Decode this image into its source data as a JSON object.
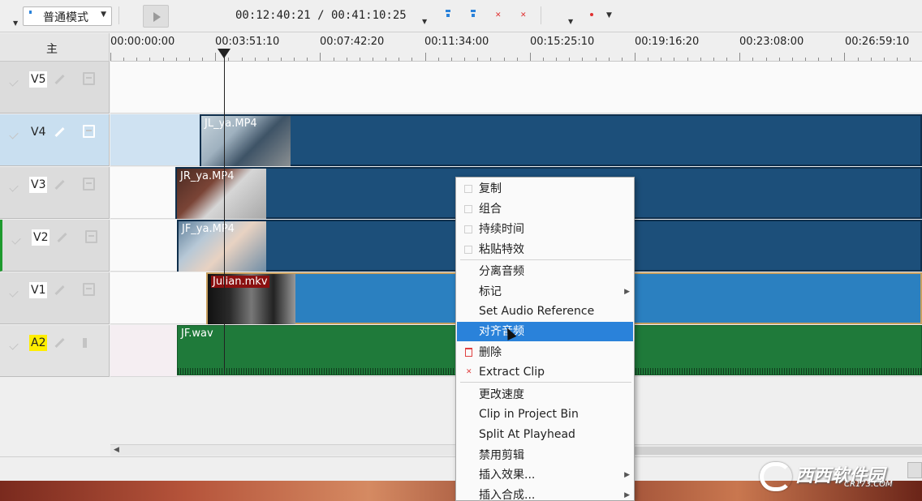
{
  "toolbar": {
    "mode": "普通模式",
    "timecode": "00:12:40:21 / 00:41:10:25"
  },
  "track_header": {
    "label": "主"
  },
  "ruler": {
    "labels": [
      "00:00:00:00",
      "00:03:51:10",
      "00:07:42:20",
      "00:11:34:00",
      "00:15:25:10",
      "00:19:16:20",
      "00:23:08:00",
      "00:26:59:10"
    ]
  },
  "tracks": [
    {
      "name": "V5"
    },
    {
      "name": "V4"
    },
    {
      "name": "V3"
    },
    {
      "name": "V2"
    },
    {
      "name": "V1"
    },
    {
      "name": "A2"
    }
  ],
  "clips": {
    "v4": "JL_ya.MP4",
    "v3": "JR_ya.MP4",
    "v2": "JF_ya.MP4",
    "v1": "Julian.mkv",
    "a2": "JF.wav"
  },
  "context_menu": {
    "items": [
      {
        "label": "复制",
        "icon": "copy-icon"
      },
      {
        "label": "组合",
        "icon": "group-icon"
      },
      {
        "label": "持续时间",
        "icon": "duration-icon"
      },
      {
        "label": "粘贴特效",
        "icon": "paste-effect-icon"
      },
      {
        "label": "分离音频"
      },
      {
        "label": "标记",
        "submenu": true
      },
      {
        "label": "Set Audio Reference"
      },
      {
        "label": "对齐音频",
        "selected": true
      },
      {
        "label": "删除",
        "icon": "trash-icon"
      },
      {
        "label": "Extract Clip",
        "icon": "extract-icon"
      },
      {
        "label": "更改速度"
      },
      {
        "label": "Clip in Project Bin"
      },
      {
        "label": "Split At Playhead"
      },
      {
        "label": "禁用剪辑"
      },
      {
        "label": "插入效果...",
        "submenu": true
      },
      {
        "label": "插入合成...",
        "submenu": true
      }
    ]
  },
  "watermark": {
    "title": "西西软件园",
    "url": "CR173.COM"
  },
  "colors": {
    "accent": "#2a82da",
    "video_clip": "#1c4f7a",
    "video_clip_selected": "#2b80c0",
    "audio_clip": "#1f7a3a",
    "highlight_track_bg": "#c9dff0"
  }
}
